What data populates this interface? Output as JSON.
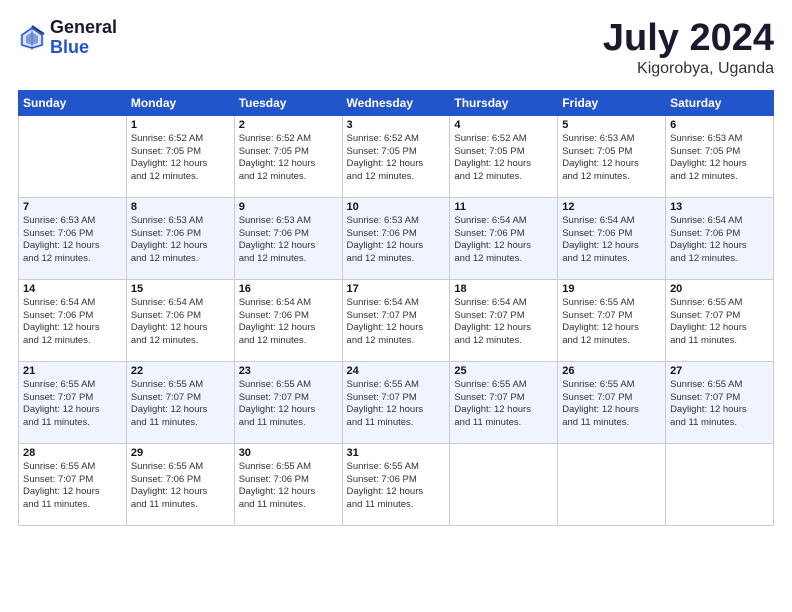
{
  "header": {
    "logo_general": "General",
    "logo_blue": "Blue",
    "month_title": "July 2024",
    "location": "Kigorobya, Uganda"
  },
  "weekdays": [
    "Sunday",
    "Monday",
    "Tuesday",
    "Wednesday",
    "Thursday",
    "Friday",
    "Saturday"
  ],
  "weeks": [
    [
      {
        "day": "",
        "info": ""
      },
      {
        "day": "1",
        "info": "Sunrise: 6:52 AM\nSunset: 7:05 PM\nDaylight: 12 hours\nand 12 minutes."
      },
      {
        "day": "2",
        "info": "Sunrise: 6:52 AM\nSunset: 7:05 PM\nDaylight: 12 hours\nand 12 minutes."
      },
      {
        "day": "3",
        "info": "Sunrise: 6:52 AM\nSunset: 7:05 PM\nDaylight: 12 hours\nand 12 minutes."
      },
      {
        "day": "4",
        "info": "Sunrise: 6:52 AM\nSunset: 7:05 PM\nDaylight: 12 hours\nand 12 minutes."
      },
      {
        "day": "5",
        "info": "Sunrise: 6:53 AM\nSunset: 7:05 PM\nDaylight: 12 hours\nand 12 minutes."
      },
      {
        "day": "6",
        "info": "Sunrise: 6:53 AM\nSunset: 7:05 PM\nDaylight: 12 hours\nand 12 minutes."
      }
    ],
    [
      {
        "day": "7",
        "info": "Sunrise: 6:53 AM\nSunset: 7:06 PM\nDaylight: 12 hours\nand 12 minutes."
      },
      {
        "day": "8",
        "info": "Sunrise: 6:53 AM\nSunset: 7:06 PM\nDaylight: 12 hours\nand 12 minutes."
      },
      {
        "day": "9",
        "info": "Sunrise: 6:53 AM\nSunset: 7:06 PM\nDaylight: 12 hours\nand 12 minutes."
      },
      {
        "day": "10",
        "info": "Sunrise: 6:53 AM\nSunset: 7:06 PM\nDaylight: 12 hours\nand 12 minutes."
      },
      {
        "day": "11",
        "info": "Sunrise: 6:54 AM\nSunset: 7:06 PM\nDaylight: 12 hours\nand 12 minutes."
      },
      {
        "day": "12",
        "info": "Sunrise: 6:54 AM\nSunset: 7:06 PM\nDaylight: 12 hours\nand 12 minutes."
      },
      {
        "day": "13",
        "info": "Sunrise: 6:54 AM\nSunset: 7:06 PM\nDaylight: 12 hours\nand 12 minutes."
      }
    ],
    [
      {
        "day": "14",
        "info": "Sunrise: 6:54 AM\nSunset: 7:06 PM\nDaylight: 12 hours\nand 12 minutes."
      },
      {
        "day": "15",
        "info": "Sunrise: 6:54 AM\nSunset: 7:06 PM\nDaylight: 12 hours\nand 12 minutes."
      },
      {
        "day": "16",
        "info": "Sunrise: 6:54 AM\nSunset: 7:06 PM\nDaylight: 12 hours\nand 12 minutes."
      },
      {
        "day": "17",
        "info": "Sunrise: 6:54 AM\nSunset: 7:07 PM\nDaylight: 12 hours\nand 12 minutes."
      },
      {
        "day": "18",
        "info": "Sunrise: 6:54 AM\nSunset: 7:07 PM\nDaylight: 12 hours\nand 12 minutes."
      },
      {
        "day": "19",
        "info": "Sunrise: 6:55 AM\nSunset: 7:07 PM\nDaylight: 12 hours\nand 12 minutes."
      },
      {
        "day": "20",
        "info": "Sunrise: 6:55 AM\nSunset: 7:07 PM\nDaylight: 12 hours\nand 11 minutes."
      }
    ],
    [
      {
        "day": "21",
        "info": "Sunrise: 6:55 AM\nSunset: 7:07 PM\nDaylight: 12 hours\nand 11 minutes."
      },
      {
        "day": "22",
        "info": "Sunrise: 6:55 AM\nSunset: 7:07 PM\nDaylight: 12 hours\nand 11 minutes."
      },
      {
        "day": "23",
        "info": "Sunrise: 6:55 AM\nSunset: 7:07 PM\nDaylight: 12 hours\nand 11 minutes."
      },
      {
        "day": "24",
        "info": "Sunrise: 6:55 AM\nSunset: 7:07 PM\nDaylight: 12 hours\nand 11 minutes."
      },
      {
        "day": "25",
        "info": "Sunrise: 6:55 AM\nSunset: 7:07 PM\nDaylight: 12 hours\nand 11 minutes."
      },
      {
        "day": "26",
        "info": "Sunrise: 6:55 AM\nSunset: 7:07 PM\nDaylight: 12 hours\nand 11 minutes."
      },
      {
        "day": "27",
        "info": "Sunrise: 6:55 AM\nSunset: 7:07 PM\nDaylight: 12 hours\nand 11 minutes."
      }
    ],
    [
      {
        "day": "28",
        "info": "Sunrise: 6:55 AM\nSunset: 7:07 PM\nDaylight: 12 hours\nand 11 minutes."
      },
      {
        "day": "29",
        "info": "Sunrise: 6:55 AM\nSunset: 7:06 PM\nDaylight: 12 hours\nand 11 minutes."
      },
      {
        "day": "30",
        "info": "Sunrise: 6:55 AM\nSunset: 7:06 PM\nDaylight: 12 hours\nand 11 minutes."
      },
      {
        "day": "31",
        "info": "Sunrise: 6:55 AM\nSunset: 7:06 PM\nDaylight: 12 hours\nand 11 minutes."
      },
      {
        "day": "",
        "info": ""
      },
      {
        "day": "",
        "info": ""
      },
      {
        "day": "",
        "info": ""
      }
    ]
  ]
}
